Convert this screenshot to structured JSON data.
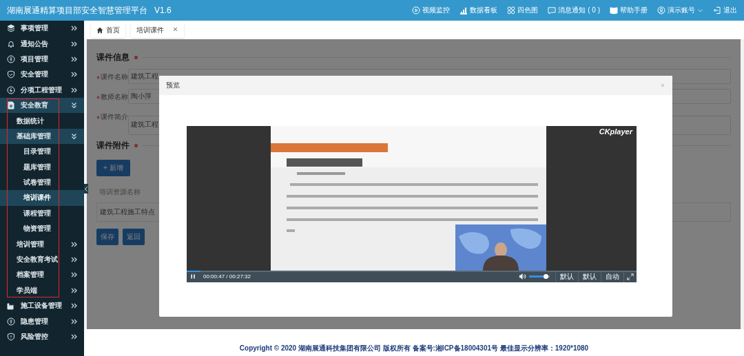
{
  "header": {
    "title": "湖南展通精算项目部安全智慧管理平台",
    "version": "V1.6",
    "nav": [
      {
        "label": "视频监控",
        "kind": "link"
      },
      {
        "label": "数据看板",
        "kind": "link"
      },
      {
        "label": "四色图",
        "kind": "link"
      },
      {
        "label": "消息通知 ( 0 )",
        "kind": "link"
      },
      {
        "label": "帮助手册",
        "kind": "link"
      },
      {
        "label": "演示账号",
        "kind": "menu"
      },
      {
        "label": "退出",
        "kind": "link"
      }
    ]
  },
  "sidebar": {
    "items": [
      {
        "label": "事项管理",
        "selected": false,
        "expanded": false
      },
      {
        "label": "通知公告",
        "selected": false,
        "expanded": false
      },
      {
        "label": "项目管理",
        "selected": false,
        "expanded": false
      },
      {
        "label": "安全管理",
        "selected": false,
        "expanded": false
      },
      {
        "label": "分项工程管理",
        "selected": false,
        "expanded": false
      },
      {
        "label": "安全教育",
        "selected": false,
        "expanded": true,
        "children": [
          {
            "label": "数据统计",
            "selected": false
          },
          {
            "label": "基础库管理",
            "selected": false,
            "expanded": true,
            "children": [
              {
                "label": "目录管理",
                "selected": false
              },
              {
                "label": "题库管理",
                "selected": false
              },
              {
                "label": "试卷管理",
                "selected": false
              },
              {
                "label": "培训课件",
                "selected": true
              },
              {
                "label": "课程管理",
                "selected": false
              },
              {
                "label": "物资管理",
                "selected": false
              }
            ]
          },
          {
            "label": "培训管理",
            "selected": false,
            "expanded": false
          },
          {
            "label": "安全教育考试",
            "selected": false,
            "expanded": false
          },
          {
            "label": "档案管理",
            "selected": false,
            "expanded": false
          },
          {
            "label": "学员端",
            "selected": false,
            "expanded": false
          }
        ]
      },
      {
        "label": "施工设备管理",
        "selected": false,
        "expanded": false
      },
      {
        "label": "隐患管理",
        "selected": false,
        "expanded": false
      },
      {
        "label": "风险管控",
        "selected": false,
        "expanded": false
      }
    ]
  },
  "tabs": [
    {
      "label": "首页",
      "kind": "home"
    },
    {
      "label": "培训课件",
      "kind": "page"
    }
  ],
  "form": {
    "sections": [
      {
        "title": "课件信息",
        "required": true,
        "fields": [
          {
            "label": "课件名称",
            "value": "建筑工程",
            "required": true,
            "kind": "input"
          },
          {
            "label": "教师名称",
            "value": "陶小萍",
            "required": true,
            "kind": "input"
          },
          {
            "label": "课件简介",
            "value": "建筑工程",
            "required": true,
            "kind": "textarea"
          }
        ]
      },
      {
        "title": "课件附件",
        "required": true,
        "add_button": "+ 新增",
        "table": {
          "columns": [
            "培训资源名称"
          ],
          "rows": [
            [
              "建筑工程施工特点"
            ]
          ]
        }
      }
    ],
    "buttons": [
      "保存",
      "返回"
    ]
  },
  "modal": {
    "title": "预览",
    "player": {
      "brand": "CKplayer",
      "playing": true,
      "time": "00:00:47 / 00:27:32",
      "progress": {
        "level": 0.03
      },
      "volume": {
        "level": 0.8
      },
      "options": [
        "默认",
        "默认",
        "自动"
      ]
    }
  },
  "footer": {
    "text": "Copyright © 2020 湖南展通科技集团有限公司 版权所有 备案号:湘ICP备18004301号 最佳显示分辨率：1920*1080"
  }
}
